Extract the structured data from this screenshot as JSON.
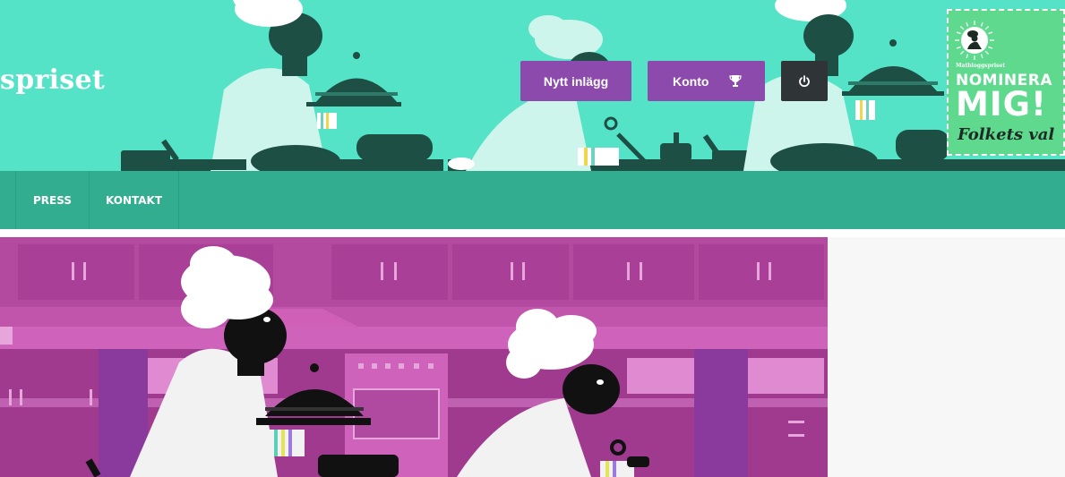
{
  "header": {
    "site_title": "spriset",
    "background_color": "#55e3c8"
  },
  "actions": {
    "new_post_label": "Nytt inlägg",
    "account_label": "Konto",
    "account_icon": "trophy-icon",
    "logout_icon": "power-icon",
    "button_color": "#8c4aad",
    "logout_color": "#2f3436"
  },
  "badge": {
    "small_text": "Matbloggspriset",
    "line1": "NOMINERA",
    "line2": "MIG!",
    "line3": "Folkets val",
    "color": "#5ed98e"
  },
  "nav": {
    "items": [
      {
        "label": "PRESS"
      },
      {
        "label": "KONTAKT"
      }
    ],
    "color": "#33ad90"
  },
  "hero": {
    "background_color": "#c155ac"
  }
}
